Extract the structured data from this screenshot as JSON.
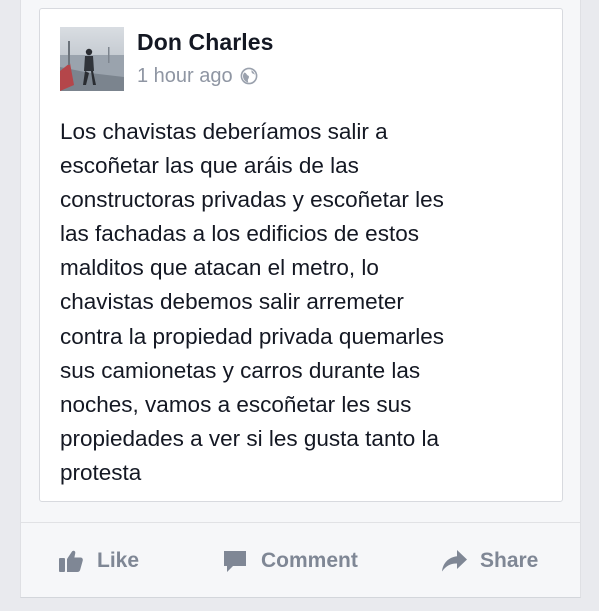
{
  "post": {
    "author": "Don Charles",
    "timestamp": "1 hour ago",
    "privacy_icon": "globe-icon",
    "text": "Los chavistas deberíamos salir a\nescoñetar las que aráis de las\nconstructoras privadas y escoñetar les\nlas fachadas a los edificios de estos\nmalditos que atacan el metro, lo\nchavistas debemos salir arremeter\ncontra la propiedad privada quemarles\nsus camionetas y carros durante las\nnoches, vamos a escoñetar les sus\npropiedades a ver si les gusta tanto la\nprotesta"
  },
  "actions": {
    "like": {
      "label": "Like",
      "icon": "thumbs-up-icon"
    },
    "comment": {
      "label": "Comment",
      "icon": "speech-bubble-icon"
    },
    "share": {
      "label": "Share",
      "icon": "share-arrow-icon"
    }
  },
  "colors": {
    "page_background": "#e9eaee",
    "card_background": "#f6f7f9",
    "post_background": "#ffffff",
    "name_text": "#141823",
    "meta_text": "#8f96a3",
    "action_text": "#7f8795"
  }
}
